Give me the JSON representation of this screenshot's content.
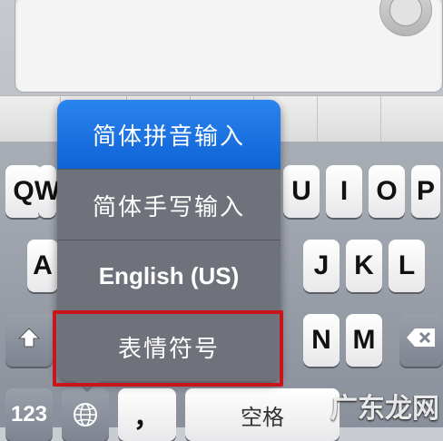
{
  "keyboard": {
    "row1": [
      "Q",
      "W",
      "U",
      "I",
      "O",
      "P"
    ],
    "row2": [
      "A",
      "J",
      "K",
      "L"
    ],
    "row3": [
      "N",
      "M"
    ],
    "numbers_key": "123",
    "comma_key": "，",
    "space_key": "空格"
  },
  "popup": {
    "items": [
      "简体拼音输入",
      "简体手写输入",
      "English (US)",
      "表情符号"
    ],
    "selected_index": 0,
    "highlighted_index": 3
  },
  "colors": {
    "selected_item": "#1a6fe0",
    "highlight_border": "#c8151b",
    "popup_bg": "#6f727a"
  },
  "watermark": {
    "text": "广东龙网"
  }
}
